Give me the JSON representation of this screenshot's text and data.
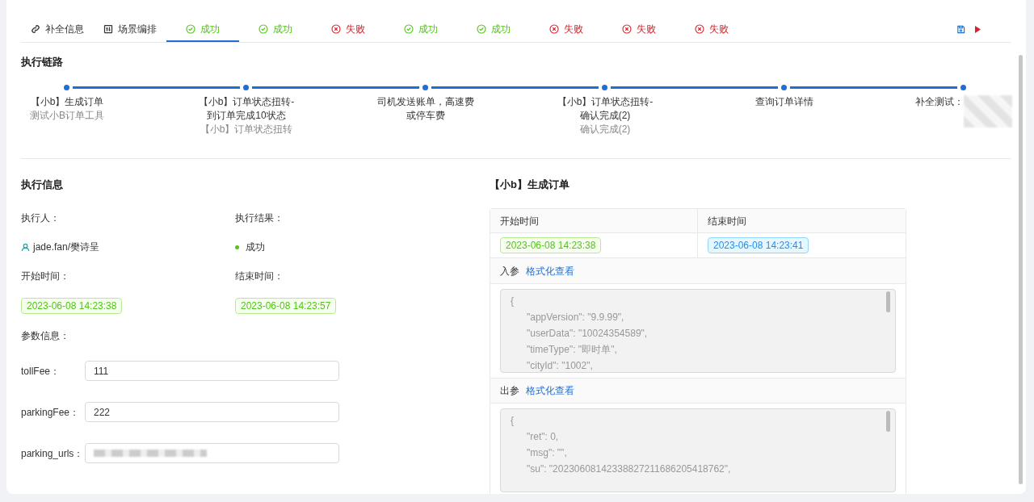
{
  "tabs": [
    {
      "label": "补全信息",
      "kind": "link",
      "selected": false
    },
    {
      "label": "场景编排",
      "kind": "layout",
      "selected": false
    },
    {
      "label": "成功",
      "kind": "success",
      "selected": true
    },
    {
      "label": "成功",
      "kind": "success",
      "selected": false
    },
    {
      "label": "失败",
      "kind": "fail",
      "selected": false
    },
    {
      "label": "成功",
      "kind": "success",
      "selected": false
    },
    {
      "label": "成功",
      "kind": "success",
      "selected": false
    },
    {
      "label": "失败",
      "kind": "fail",
      "selected": false
    },
    {
      "label": "失败",
      "kind": "fail",
      "selected": false
    },
    {
      "label": "失败",
      "kind": "fail",
      "selected": false
    }
  ],
  "chain": {
    "title": "执行链路",
    "steps": [
      {
        "title": "【小b】生成订单",
        "subtitle": "测试小B订单工具"
      },
      {
        "title": "【小b】订单状态扭转-到订单完成10状态",
        "subtitle": "【小b】订单状态扭转"
      },
      {
        "title": "司机发送账单，高速费或停车费"
      },
      {
        "title": "【小b】订单状态扭转-确认完成(2)",
        "subtitle": "确认完成(2)"
      },
      {
        "title": "查询订单详情"
      },
      {
        "title": "补全测试：",
        "obscured": true
      }
    ]
  },
  "exec_info": {
    "title": "执行信息",
    "executor_label": "执行人：",
    "executor": "jade.fan/樊诗呈",
    "result_label": "执行结果：",
    "result": "成功",
    "start_label": "开始时间：",
    "start": "2023-06-08 14:23:38",
    "end_label": "结束时间：",
    "end": "2023-06-08 14:23:57",
    "params_label": "参数信息：",
    "params": [
      {
        "label": "tollFee：",
        "value": "111"
      },
      {
        "label": "parkingFee：",
        "value": "222"
      },
      {
        "label": "parking_urls：",
        "obscured": true
      }
    ]
  },
  "step_detail": {
    "title": "【小b】生成订单",
    "start_header": "开始时间",
    "end_header": "结束时间",
    "start": "2023-06-08 14:23:38",
    "end": "2023-06-08 14:23:41",
    "input_label": "入参",
    "input_link": "格式化查看",
    "input_lines": [
      "{",
      "\"appVersion\": \"9.9.99\",",
      "\"userData\": \"10024354589\",",
      "\"timeType\": \"即时单\",",
      "\"cityId\": \"1002\","
    ],
    "output_label": "出参",
    "output_link": "格式化查看",
    "output_lines": [
      "{",
      "\"ret\": 0,",
      "\"msg\": \"\",",
      "\"su\": \"20230608142338827211686205418762\","
    ]
  }
}
